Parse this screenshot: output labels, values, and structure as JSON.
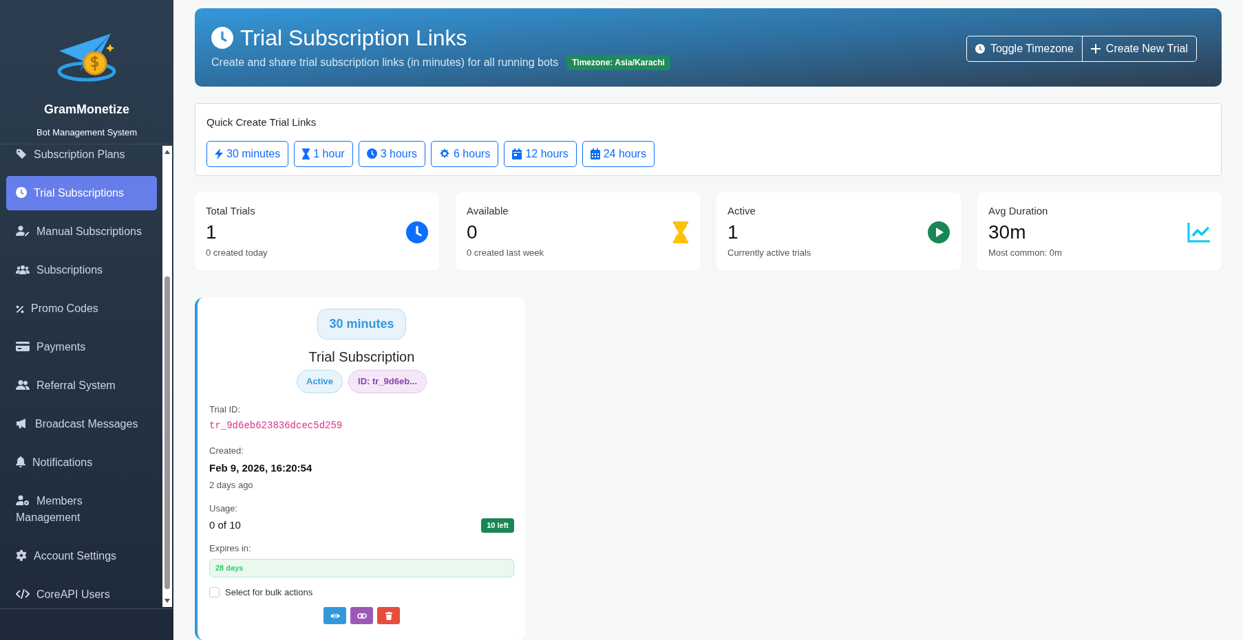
{
  "sidebar": {
    "brand": "GramMonetize",
    "subtitle": "Bot Management System",
    "items": [
      {
        "label": "Subscription Plans",
        "selected": false
      },
      {
        "label": "Trial Subscriptions",
        "selected": true
      },
      {
        "label": "Manual Subscriptions",
        "selected": false
      },
      {
        "label": "Subscriptions",
        "selected": false
      },
      {
        "label": "Promo Codes",
        "selected": false
      },
      {
        "label": "Payments",
        "selected": false
      },
      {
        "label": "Referral System",
        "selected": false
      },
      {
        "label": "Broadcast Messages",
        "selected": false
      },
      {
        "label": "Notifications",
        "selected": false
      },
      {
        "label": "Members Management",
        "selected": false
      },
      {
        "label": "Account Settings",
        "selected": false
      },
      {
        "label": "CoreAPI Users",
        "selected": false
      }
    ]
  },
  "header": {
    "title": "Trial Subscription Links",
    "subtitle": "Create and share trial subscription links (in minutes) for all running bots",
    "timezone_badge": "Timezone: Asia/Karachi",
    "buttons": [
      "Toggle Timezone",
      "Create New Trial"
    ]
  },
  "quick_create": {
    "title": "Quick Create Trial Links",
    "buttons": [
      "30 minutes",
      "1 hour",
      "3 hours",
      "6 hours",
      "12 hours",
      "24 hours"
    ]
  },
  "stats": [
    {
      "label": "Total Trials",
      "value": "1",
      "note": "0 created today"
    },
    {
      "label": "Available",
      "value": "0",
      "note": "0 created last week"
    },
    {
      "label": "Active",
      "value": "1",
      "note": "Currently active trials"
    },
    {
      "label": "Avg Duration",
      "value": "30m",
      "note": "Most common: 0m"
    }
  ],
  "trials": [
    {
      "duration": "30 minutes",
      "title": "Trial Subscription",
      "status": "Active",
      "id_badge": "ID: tr_9d6eb...",
      "trial_id_label": "Trial ID:",
      "trial_id": "tr_9d6eb623836dcec5d259",
      "created_label": "Created:",
      "created": "Feb 9, 2026, 16:20:54",
      "created_ago": "2 days ago",
      "usage_label": "Usage:",
      "usage": "0 of 10",
      "remaining": "10 left",
      "expires_label": "Expires in:",
      "expires": "28 days",
      "select_label": "Select for bulk actions",
      "checked": false
    }
  ]
}
